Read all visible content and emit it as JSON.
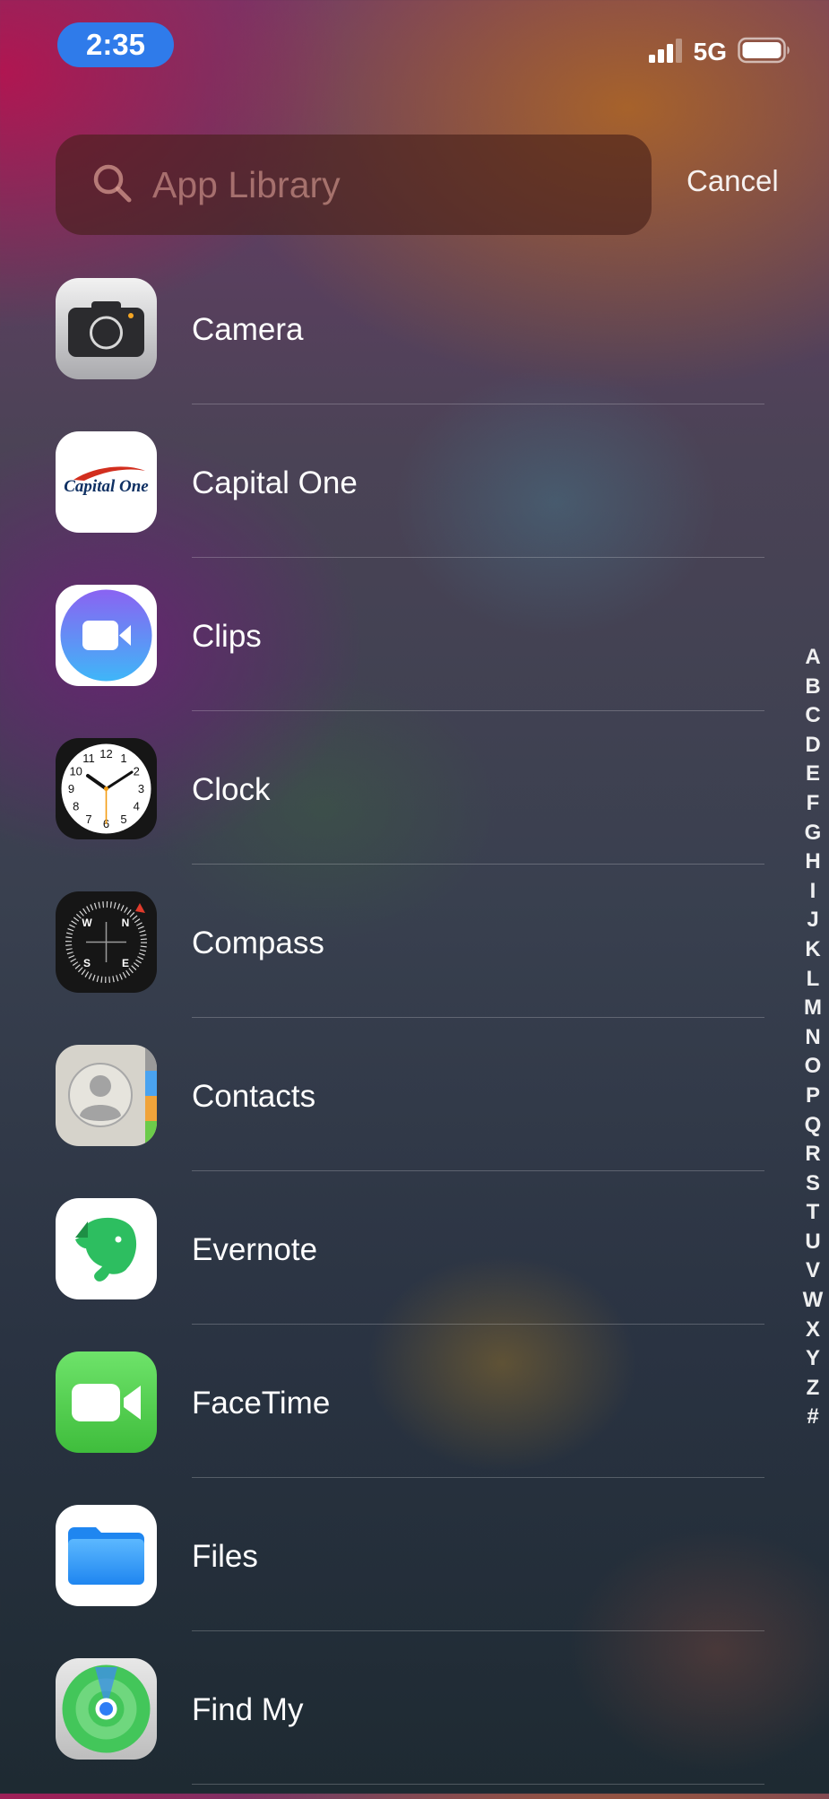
{
  "status_bar": {
    "time": "2:35",
    "network": "5G",
    "signal_icon": "signal-bars-icon",
    "battery_icon": "battery-icon",
    "time_pill_color": "#2f7bea"
  },
  "search": {
    "placeholder": "App Library",
    "value": "",
    "icon": "search-icon",
    "cancel_label": "Cancel"
  },
  "apps": [
    {
      "name": "Camera",
      "icon": "camera-icon"
    },
    {
      "name": "Capital One",
      "icon": "capital-one-icon"
    },
    {
      "name": "Clips",
      "icon": "clips-icon"
    },
    {
      "name": "Clock",
      "icon": "clock-icon"
    },
    {
      "name": "Compass",
      "icon": "compass-icon"
    },
    {
      "name": "Contacts",
      "icon": "contacts-icon"
    },
    {
      "name": "Evernote",
      "icon": "evernote-icon"
    },
    {
      "name": "FaceTime",
      "icon": "facetime-icon"
    },
    {
      "name": "Files",
      "icon": "files-icon"
    },
    {
      "name": "Find My",
      "icon": "find-my-icon"
    }
  ],
  "icon_text": {
    "capital_one_logo": "Capital One",
    "clock_numbers": [
      "12",
      "1",
      "2",
      "3",
      "4",
      "5",
      "6",
      "7",
      "8",
      "9",
      "10",
      "11"
    ],
    "compass_directions": [
      "N",
      "E",
      "S",
      "W"
    ]
  },
  "index_letters": [
    "A",
    "B",
    "C",
    "D",
    "E",
    "F",
    "G",
    "H",
    "I",
    "J",
    "K",
    "L",
    "M",
    "N",
    "O",
    "P",
    "Q",
    "R",
    "S",
    "T",
    "U",
    "V",
    "W",
    "X",
    "Y",
    "Z",
    "#"
  ]
}
